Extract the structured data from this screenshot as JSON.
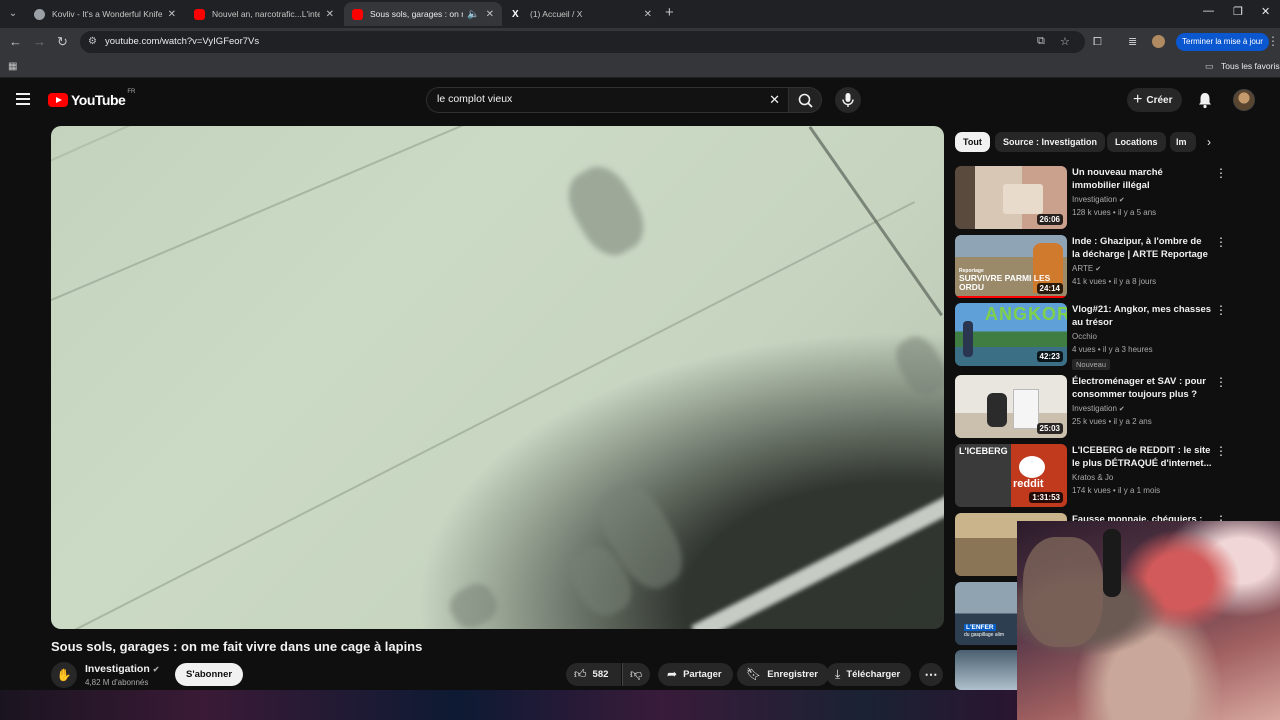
{
  "browser": {
    "tabs": [
      {
        "title": "Kovliv - It's a Wonderful Knife (",
        "favicon_color": "#9aa0a6",
        "active": false
      },
      {
        "title": "Nouvel an, narcotrafic...L'interv",
        "favicon_color": "#ff0000",
        "active": false
      },
      {
        "title": "Sous sols, garages : on me",
        "favicon_color": "#ff0000",
        "active": true
      },
      {
        "title": "(1) Accueil / X",
        "favicon_color": "#ffffff",
        "active": false
      }
    ],
    "url": "youtube.com/watch?v=VyIGFeor7Vs",
    "update_label": "Terminer la mise à jour",
    "bookmarks_all_label": "Tous les favoris"
  },
  "youtube": {
    "logo_text": "YouTube",
    "country": "FR",
    "search_value": "le complot vieux",
    "create_label": "Créer"
  },
  "video": {
    "title": "Sous sols, garages : on me fait vivre dans une cage à lapins",
    "channel": "Investigation",
    "subscribers": "4,82 M d'abonnés",
    "subscribe_label": "S'abonner",
    "likes": "582",
    "share_label": "Partager",
    "save_label": "Enregistrer",
    "download_label": "Télécharger"
  },
  "chips": [
    "Tout",
    "Source : Investigation",
    "Locations",
    "Im"
  ],
  "recommendations": [
    {
      "title": "Un nouveau marché immobilier illégal",
      "channel": "Investigation",
      "verified": true,
      "meta": "128 k vues • il y a 5 ans",
      "duration": "26:06",
      "thumb_colors": [
        "#d8c7b5",
        "#8a6e5c"
      ]
    },
    {
      "title": "Inde : Ghazipur, à l'ombre de la décharge | ARTE Reportage",
      "channel": "ARTE",
      "verified": true,
      "meta": "41 k vues • il y a 8 jours",
      "duration": "24:14",
      "thumb_colors": [
        "#7f8f9c",
        "#b08b5a"
      ],
      "overlay_text": "SURVIVRE PARMI LES ORDU",
      "overlay_small": "Reportage"
    },
    {
      "title": "Vlog#21: Angkor, mes chasses au trésor",
      "channel": "Occhio",
      "verified": false,
      "meta": "4 vues • il y a 3 heures",
      "duration": "42:23",
      "badge": "Nouveau",
      "thumb_colors": [
        "#4a8fc9",
        "#3b7a3f"
      ],
      "overlay_text": "ANGKOR"
    },
    {
      "title": "Électroménager et SAV : pour consommer toujours plus ?",
      "channel": "Investigation",
      "verified": true,
      "meta": "25 k vues • il y a 2 ans",
      "duration": "25:03",
      "thumb_colors": [
        "#e6e1d8",
        "#b8aa98"
      ]
    },
    {
      "title": "L'ICEBERG de REDDIT : le site le plus DÉTRAQUÉ d'internet...",
      "channel": "Kratos & Jo",
      "verified": false,
      "meta": "174 k vues • il y a 1 mois",
      "duration": "1:31:53",
      "thumb_colors": [
        "#2a2a2a",
        "#d94b2b"
      ],
      "overlay_text": "L'ICEBERG",
      "overlay_small": "reddit"
    },
    {
      "title": "Fausse monnaie, chéquiers :",
      "channel": "",
      "verified": false,
      "meta": "",
      "duration": "",
      "thumb_colors": [
        "#c9b48c",
        "#6b5a40"
      ]
    }
  ],
  "extra_thumbs": [
    {
      "overlay_text": "L'ENFER",
      "overlay_small": "du gaspillage alim",
      "thumb_colors": [
        "#8fa3b0",
        "#2c3e50"
      ]
    },
    {
      "thumb_colors": [
        "#4a6070",
        "#b0c0cc"
      ]
    }
  ]
}
